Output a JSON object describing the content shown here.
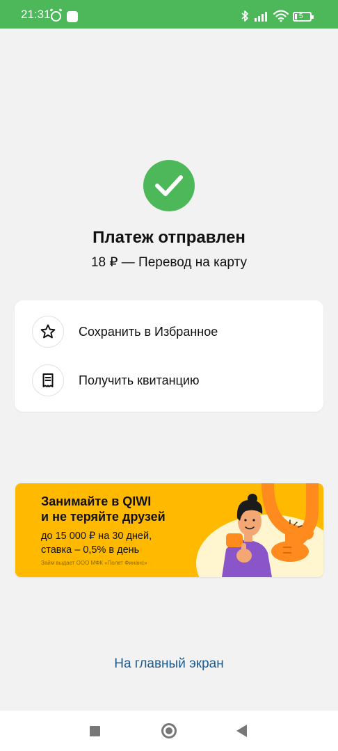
{
  "status_bar": {
    "time": "21:31",
    "battery": "5",
    "icons": [
      "alarm-icon",
      "notification-icon",
      "bluetooth-icon",
      "signal-icon",
      "wifi-icon",
      "battery-icon"
    ],
    "background": "#4cb85a"
  },
  "result": {
    "icon": "check-icon",
    "title": "Платеж отправлен",
    "subtitle": "18 ₽ — Перевод на карту"
  },
  "actions": [
    {
      "label": "Сохранить в Избранное",
      "icon": "star-icon"
    },
    {
      "label": "Получить квитанцию",
      "icon": "receipt-icon"
    }
  ],
  "promo": {
    "title": "Занимайте в QIWI\nи не теряйте друзей",
    "text": "до 15 000 ₽ на 30 дней,\nставка – 0,5% в день",
    "disclaimer": "Займ выдает ООО МФК «Полет Финанс»",
    "background": "#ffba00"
  },
  "footer": {
    "home_link": "На главный экран"
  },
  "colors": {
    "success": "#4cb85a",
    "link": "#1e5a8e",
    "page_background": "#f2f2f2"
  }
}
